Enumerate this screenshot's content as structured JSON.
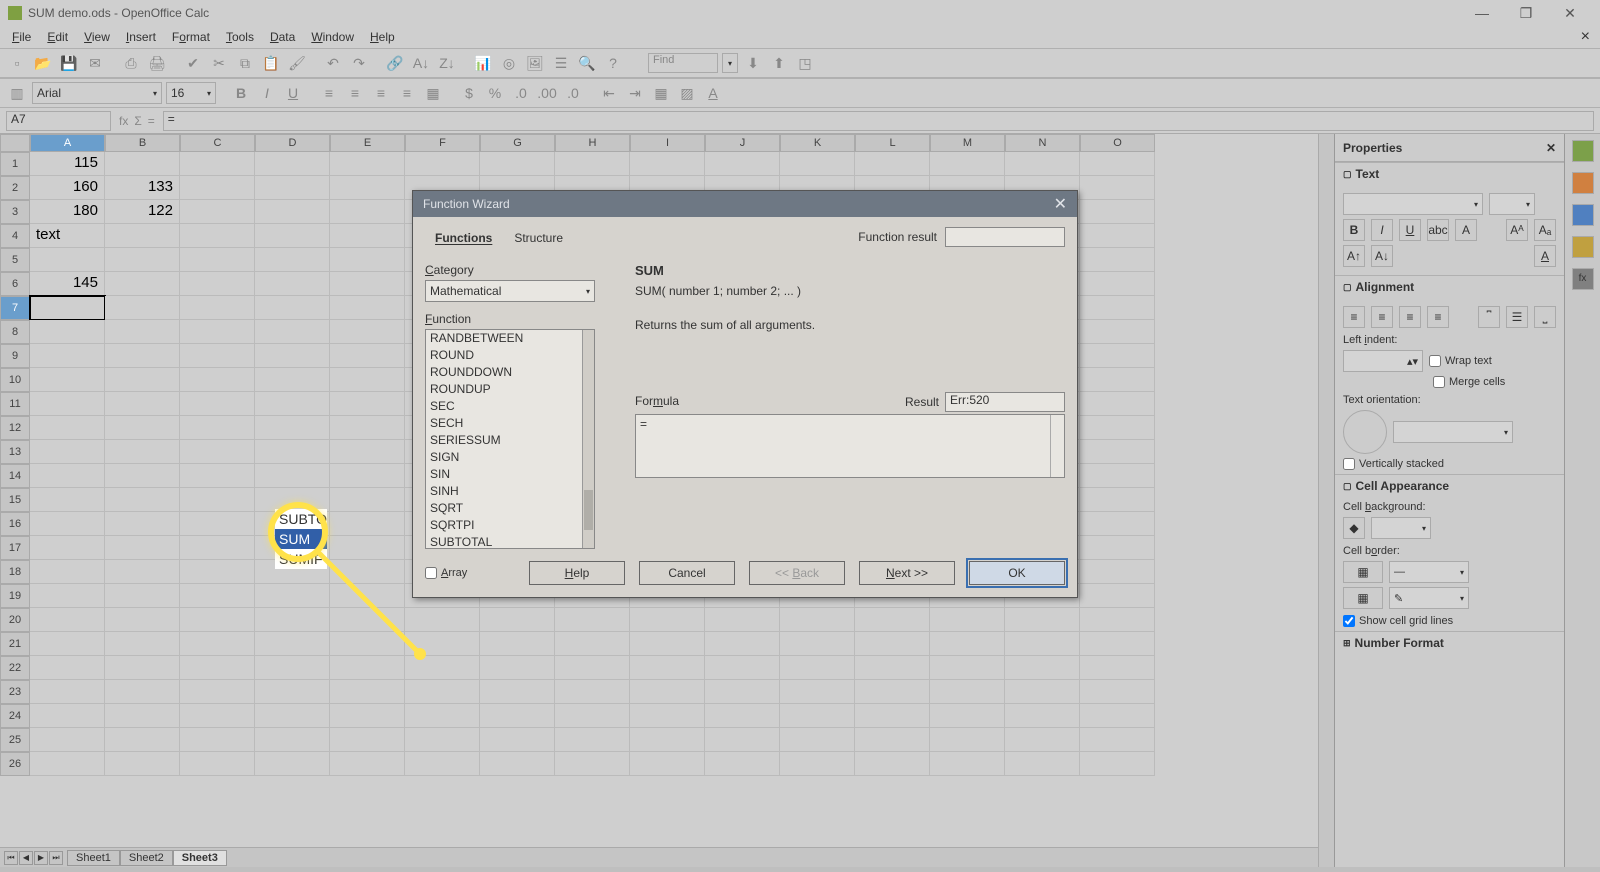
{
  "window": {
    "title": "SUM demo.ods - OpenOffice Calc"
  },
  "menu": {
    "file": "File",
    "edit": "Edit",
    "view": "View",
    "insert": "Insert",
    "format": "Format",
    "tools": "Tools",
    "data": "Data",
    "window": "Window",
    "help": "Help"
  },
  "toolbar": {
    "find_placeholder": "Find"
  },
  "format": {
    "font": "Arial",
    "size": "16"
  },
  "namebox": "A7",
  "formula_input": "=",
  "columns": [
    "A",
    "B",
    "C",
    "D",
    "E",
    "F",
    "G",
    "H",
    "I",
    "J",
    "K",
    "L",
    "M",
    "N",
    "O"
  ],
  "rows": [
    "1",
    "2",
    "3",
    "4",
    "5",
    "6",
    "7",
    "8",
    "9",
    "10",
    "11",
    "12",
    "13",
    "14",
    "15",
    "16",
    "17",
    "18",
    "19",
    "20",
    "21",
    "22",
    "23",
    "24",
    "25",
    "26"
  ],
  "cells": {
    "A1": "115",
    "A2": "160",
    "B2": "133",
    "A3": "180",
    "B3": "122",
    "A4": "text",
    "A6": "145"
  },
  "active_cell": {
    "row": "7",
    "col": "A"
  },
  "sheets": {
    "s1": "Sheet1",
    "s2": "Sheet2",
    "s3": "Sheet3"
  },
  "props": {
    "title": "Properties",
    "text": "Text",
    "alignment": "Alignment",
    "left_indent": "Left indent:",
    "wrap": "Wrap text",
    "merge": "Merge cells",
    "orientation": "Text orientation:",
    "vstack": "Vertically stacked",
    "cellapp": "Cell Appearance",
    "bg": "Cell background:",
    "border": "Cell border:",
    "gridlines": "Show cell grid lines",
    "numfmt": "Number Format"
  },
  "dialog": {
    "title": "Function Wizard",
    "tab_functions": "Functions",
    "tab_structure": "Structure",
    "func_result_lbl": "Function result",
    "category_lbl": "Category",
    "category": "Mathematical",
    "function_lbl": "Function",
    "functions": [
      "RANDBETWEEN",
      "ROUND",
      "ROUNDDOWN",
      "ROUNDUP",
      "SEC",
      "SECH",
      "SERIESSUM",
      "SIGN",
      "SIN",
      "SINH",
      "SQRT",
      "SQRTPI",
      "SUBTOTAL",
      "SUM",
      "SUMIF"
    ],
    "selected_fn": "SUM",
    "fn_sig": "SUM( number 1; number 2; ... )",
    "fn_desc": "Returns the sum of all arguments.",
    "formula_lbl": "Formula",
    "result_lbl": "Result",
    "result": "Err:520",
    "formula_value": "=",
    "array": "Array",
    "help": "Help",
    "cancel": "Cancel",
    "back": "<< Back",
    "next": "Next >>",
    "ok": "OK"
  },
  "callout": {
    "a": "SUBTO",
    "b": "SUM",
    "c": "SUMIF"
  }
}
